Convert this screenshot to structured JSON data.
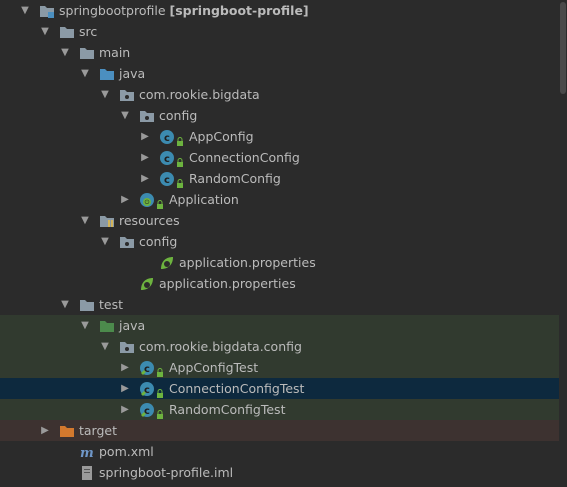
{
  "tree": {
    "rows": [
      {
        "depth": 0,
        "arrow": "down",
        "icon": "module-folder-icon",
        "label": "springbootprofile",
        "label_bold": "[springboot-profile]",
        "bg": ""
      },
      {
        "depth": 1,
        "arrow": "down",
        "icon": "folder-icon",
        "label": "src",
        "bg": ""
      },
      {
        "depth": 2,
        "arrow": "down",
        "icon": "folder-icon",
        "label": "main",
        "bg": ""
      },
      {
        "depth": 3,
        "arrow": "down",
        "icon": "source-folder-icon",
        "label": "java",
        "bg": ""
      },
      {
        "depth": 4,
        "arrow": "down",
        "icon": "package-icon",
        "label": "com.rookie.bigdata",
        "bg": ""
      },
      {
        "depth": 5,
        "arrow": "down",
        "icon": "package-icon",
        "label": "config",
        "bg": ""
      },
      {
        "depth": 6,
        "arrow": "right",
        "icon": "class-icon",
        "label": "AppConfig",
        "bg": ""
      },
      {
        "depth": 6,
        "arrow": "right",
        "icon": "class-icon",
        "label": "ConnectionConfig",
        "bg": ""
      },
      {
        "depth": 6,
        "arrow": "right",
        "icon": "class-icon",
        "label": "RandomConfig",
        "bg": ""
      },
      {
        "depth": 5,
        "arrow": "right",
        "icon": "spring-boot-class-icon",
        "label": "Application",
        "bg": ""
      },
      {
        "depth": 3,
        "arrow": "down",
        "icon": "resources-folder-icon",
        "label": "resources",
        "bg": ""
      },
      {
        "depth": 4,
        "arrow": "down",
        "icon": "package-icon",
        "label": "config",
        "bg": ""
      },
      {
        "depth": 6,
        "arrow": "none",
        "icon": "spring-properties-icon",
        "label": "application.properties",
        "bg": ""
      },
      {
        "depth": 5,
        "arrow": "none",
        "icon": "spring-properties-icon",
        "label": "application.properties",
        "bg": ""
      },
      {
        "depth": 2,
        "arrow": "down",
        "icon": "folder-icon",
        "label": "test",
        "bg": ""
      },
      {
        "depth": 3,
        "arrow": "down",
        "icon": "test-folder-icon",
        "label": "java",
        "bg": "test"
      },
      {
        "depth": 4,
        "arrow": "down",
        "icon": "package-icon",
        "label": "com.rookie.bigdata.config",
        "bg": "test"
      },
      {
        "depth": 5,
        "arrow": "right",
        "icon": "test-class-icon",
        "label": "AppConfigTest",
        "bg": "test"
      },
      {
        "depth": 5,
        "arrow": "right",
        "icon": "test-class-icon",
        "label": "ConnectionConfigTest",
        "bg": "selected"
      },
      {
        "depth": 5,
        "arrow": "right",
        "icon": "test-class-icon",
        "label": "RandomConfigTest",
        "bg": "test"
      },
      {
        "depth": 1,
        "arrow": "right",
        "icon": "excluded-folder-icon",
        "label": "target",
        "bg": "excluded"
      },
      {
        "depth": 2,
        "arrow": "none",
        "icon": "maven-icon",
        "label": "pom.xml",
        "bg": ""
      },
      {
        "depth": 2,
        "arrow": "none",
        "icon": "iml-file-icon",
        "label": "springboot-profile.iml",
        "bg": ""
      }
    ]
  },
  "colors": {
    "background": "#2b2b2b",
    "text": "#bbbbbb",
    "selected_row": "#0d293e",
    "test_row": "#313a2f",
    "excluded_row": "#3d3230",
    "class_icon": "#3c8bb0",
    "folder_icon": "#8b9aa6",
    "source_folder_icon": "#4b8fc0",
    "test_folder_icon": "#4c8a4c",
    "excluded_folder_icon": "#d3792e",
    "spring_green": "#6db33f"
  }
}
